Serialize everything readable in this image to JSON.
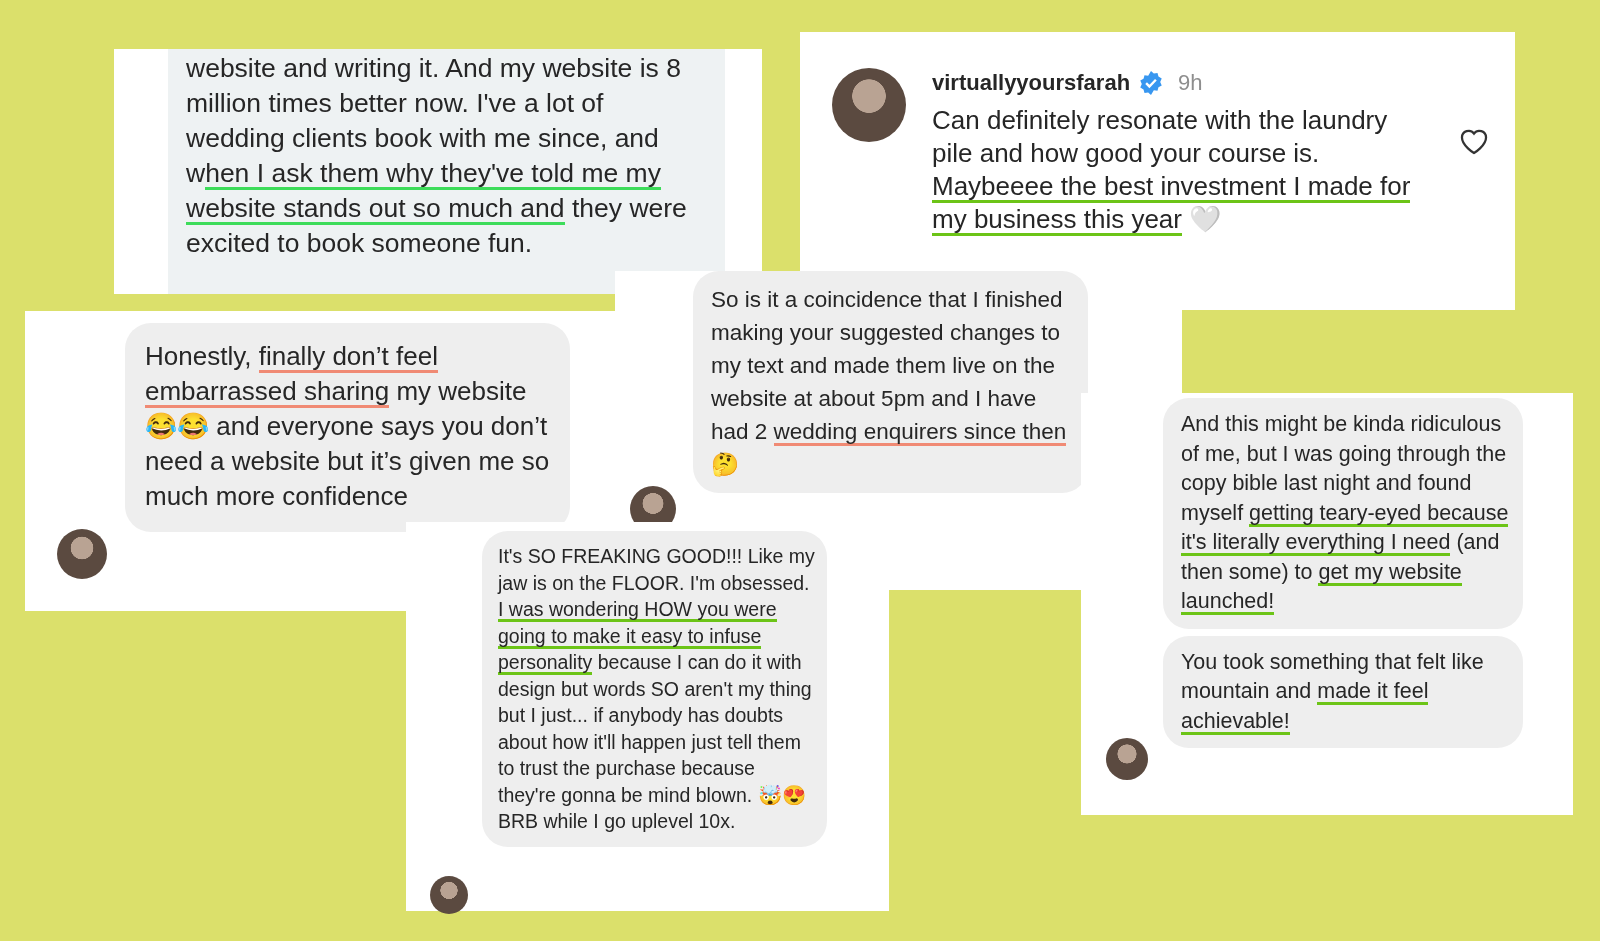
{
  "cards": [
    {
      "kind": "snippet",
      "bubbles": [
        {
          "segments": [
            {
              "text": "website and writing it. And my website is 8 million times better now. I've a lot of wedding clients book with me since, and w"
            },
            {
              "text": "hen I ask them why they've told me my website stands out so much and",
              "color": "#3ddc5a"
            },
            {
              "text": " they were excited to book someone fun."
            }
          ]
        }
      ]
    },
    {
      "kind": "comment",
      "username": "virtuallyyoursfarah",
      "verified": true,
      "time": "9h",
      "liked": false,
      "bubbles": [
        {
          "segments": [
            {
              "text": "Can definitely resonate with the laundry pile and how good your course is. "
            },
            {
              "text": "Maybeeee the best investment I made for my business this year",
              "color": "#6cc417"
            },
            {
              "text": " 🤍"
            }
          ]
        }
      ]
    },
    {
      "kind": "chat",
      "bubbles": [
        {
          "segments": [
            {
              "text": "Honestly, "
            },
            {
              "text": "finally don’t feel embarrassed sharing",
              "color": "#f08a74"
            },
            {
              "text": " my website 😂😂 and everyone says you don’t need a website but it’s given me so much more confidence"
            }
          ]
        }
      ]
    },
    {
      "kind": "chat",
      "bubbles": [
        {
          "segments": [
            {
              "text": "So is it a coincidence that I finished making your suggested changes to my text and made them live on the website at about 5pm and I have had 2 "
            },
            {
              "text": "wedding enquirers since then",
              "color": "#f08a74"
            },
            {
              "text": " 🤔"
            }
          ]
        }
      ]
    },
    {
      "kind": "chat",
      "bubbles": [
        {
          "segments": [
            {
              "text": "It's SO FREAKING GOOD!!! Like my jaw is on the FLOOR. I'm obsessed. "
            },
            {
              "text": "I was wondering HOW you were going to make it easy to infuse personality",
              "color": "#6cc417"
            },
            {
              "text": " because I can do it with design but words SO aren't my thing but I just... if anybody has doubts about how it'll happen just tell them to trust the purchase because they're gonna be mind blown. 🤯😍 BRB while I go uplevel 10x."
            }
          ]
        }
      ]
    },
    {
      "kind": "chat",
      "bubbles": [
        {
          "segments": [
            {
              "text": "And this might be kinda ridiculous of me, but I was going through the copy bible last night and found myself "
            },
            {
              "text": "getting teary-eyed because it's literally everything I need",
              "color": "#6cc417"
            },
            {
              "text": " (and then some) to "
            },
            {
              "text": "get my website launched!",
              "color": "#6cc417"
            }
          ]
        },
        {
          "segments": [
            {
              "text": "You took something that felt like mountain and "
            },
            {
              "text": "made it feel achievable!",
              "color": "#6cc417"
            }
          ]
        }
      ]
    }
  ]
}
